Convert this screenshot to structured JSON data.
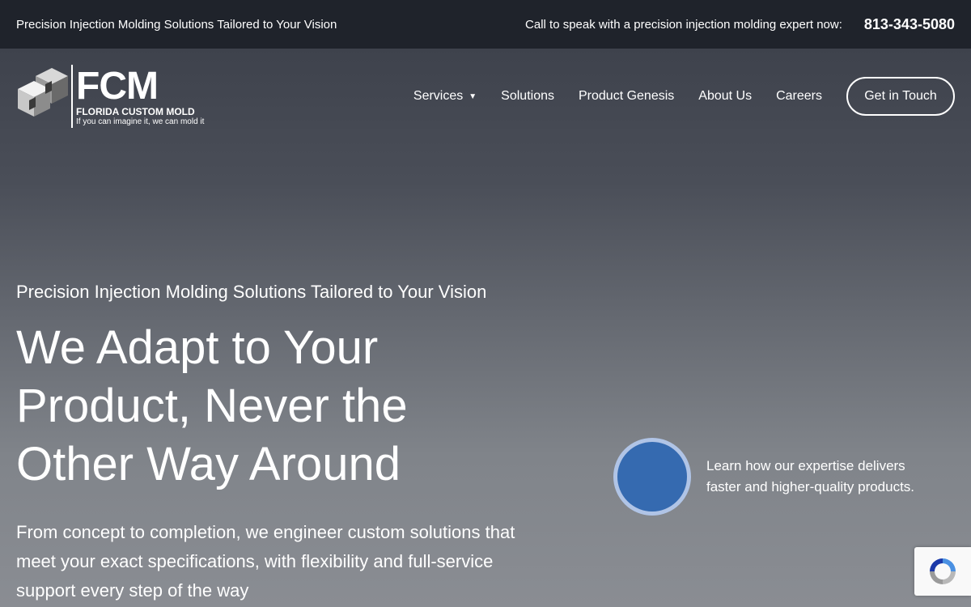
{
  "topbar": {
    "tagline": "Precision Injection Molding Solutions Tailored to Your Vision",
    "call_text": "Call to speak with a precision injection molding expert now:",
    "phone": "813-343-5080"
  },
  "logo": {
    "acronym": "FCM",
    "name": "FLORIDA CUSTOM MOLD",
    "tagline": "If you can imagine it, we can mold it"
  },
  "nav": {
    "items": [
      {
        "label": "Services",
        "has_dropdown": true
      },
      {
        "label": "Solutions"
      },
      {
        "label": "Product Genesis"
      },
      {
        "label": "About Us"
      },
      {
        "label": "Careers"
      }
    ],
    "caret": "▼",
    "cta_label": "Get in Touch"
  },
  "hero": {
    "kicker": "Precision Injection Molding Solutions Tailored to Your Vision",
    "title": "We Adapt to Your Product, Never the Other Way Around",
    "description": "From concept to completion, we engineer custom solutions that meet your exact specifications, with flexibility and full-service support every step of the way"
  },
  "video": {
    "text": "Learn how our expertise delivers faster and higher-quality products.",
    "button_color": "#356ab0"
  },
  "icons": {
    "logo": "cube-logo-icon",
    "play": "play-video-icon",
    "recaptcha": "recaptcha-icon"
  }
}
